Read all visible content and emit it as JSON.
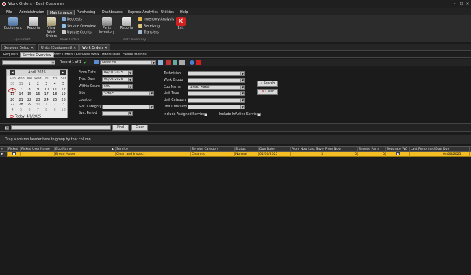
{
  "window": {
    "title": "Work Orders - Best Customer",
    "controls": [
      "–",
      "☐",
      "✕"
    ]
  },
  "menu": [
    "File",
    "Administration",
    "Maintenance",
    "Purchasing",
    "Dashboards",
    "Express Analytics",
    "Utilities",
    "Help"
  ],
  "ribbon": {
    "equipment": "Equipment",
    "reports1": "Reports",
    "view_wo": "View Work Orders",
    "requests": "Requests",
    "service_overview": "Service Overview",
    "update_counts": "Update Counts",
    "parts_inventory": "Parts Inventory",
    "reports2": "Reports",
    "inventory_analysis": "Inventory Analysis",
    "receiving": "Receiving",
    "transfers": "Transfers",
    "exit": "Exit",
    "group_equipment": "Equipment",
    "group_work_orders": "Work Orders",
    "group_parts_inventory": "Parts Inventory"
  },
  "doc_tabs": [
    "Services Setup",
    "Units (Equipment)",
    "Work Orders"
  ],
  "sub_tabs": [
    "Requests",
    "Service Overview",
    "Work Orders Overview",
    "Work Orders Data",
    "Failure Metrics"
  ],
  "toolbar": {
    "record": "Record 1 of 1",
    "show": "Show All"
  },
  "calendar": {
    "title": "April 2025",
    "dows": [
      "Sun",
      "Mon",
      "Tue",
      "Wed",
      "Thu",
      "Fri",
      "Sat"
    ],
    "weeks": [
      [
        "30",
        "31",
        "1",
        "2",
        "3",
        "4",
        "5"
      ],
      [
        "6",
        "7",
        "8",
        "9",
        "10",
        "11",
        "12"
      ],
      [
        "13",
        "14",
        "15",
        "16",
        "17",
        "18",
        "19"
      ],
      [
        "20",
        "21",
        "22",
        "23",
        "24",
        "25",
        "26"
      ],
      [
        "27",
        "28",
        "29",
        "30",
        "1",
        "2",
        "3"
      ],
      [
        "4",
        "5",
        "6",
        "7",
        "8",
        "9",
        "10"
      ]
    ],
    "today_label": "Today: 4/6/2025"
  },
  "filters": {
    "from_date_label": "From Date",
    "from_date": "04/01/2025",
    "thru_date_label": "Thru Date",
    "thru_date": "05/06/2025",
    "within_count_label": "Within Count",
    "within_count": "500",
    "site_label": "Site",
    "site": "<All>",
    "location_label": "Location",
    "svc_category_label": "Svc. Category",
    "svc_period_label": "Svc. Period",
    "technician_label": "Technician",
    "work_group_label": "Work Group",
    "eqp_name_label": "Eqp Name",
    "eqp_name": "Bread Maker",
    "unit_type_label": "Unit Type",
    "unit_category_label": "Unit Category",
    "unit_criticality_label": "Unit Criticality",
    "include_assigned": "Include Assigned Services",
    "include_inactive": "Include InActive Services",
    "search_btn": "Search",
    "clear_btn": "Clear"
  },
  "findbar": {
    "find": "Find",
    "clear": "Clear"
  },
  "group_hint": "Drag a column header here to group by that column",
  "grid": {
    "headers": [
      "Picked",
      "Picked User Name",
      "Eqp Name",
      "Service",
      "Service Category",
      "Status",
      "Due Date",
      "From Now Last Saved",
      "From Now",
      "Service Parts",
      "Separate WO",
      "Last Performed Date",
      "Due"
    ],
    "row": {
      "eqp_name": "Bread Maker",
      "service": "Clean and Inspect",
      "service_category": "Cleaning",
      "status": "Normal",
      "due_date": "04/06/2025",
      "from_now_last_saved": "3",
      "from_now": "0",
      "service_parts": "0",
      "last_performed": "",
      "due": "04/06/2025"
    }
  },
  "colors": {
    "accent": "#f3bd23",
    "bg": "#1b1b1b",
    "exit": "#d02020"
  }
}
